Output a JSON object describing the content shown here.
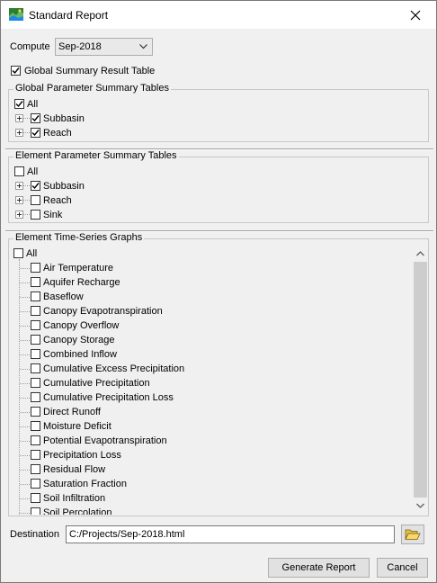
{
  "window": {
    "title": "Standard Report"
  },
  "compute": {
    "label": "Compute",
    "selected": "Sep-2018"
  },
  "global_summary": {
    "label": "Global Summary Result Table",
    "checked": true
  },
  "global_params": {
    "legend": "Global Parameter Summary Tables",
    "all_label": "All",
    "items": [
      {
        "label": "Subbasin",
        "checked": true
      },
      {
        "label": "Reach",
        "checked": true
      }
    ]
  },
  "element_params": {
    "legend": "Element Parameter Summary Tables",
    "all_label": "All",
    "items": [
      {
        "label": "Subbasin",
        "checked": true
      },
      {
        "label": "Reach",
        "checked": false
      },
      {
        "label": "Sink",
        "checked": false
      }
    ]
  },
  "time_series": {
    "legend": "Element Time-Series Graphs",
    "all_label": "All",
    "items": [
      "Air Temperature",
      "Aquifer Recharge",
      "Baseflow",
      "Canopy Evapotranspiration",
      "Canopy Overflow",
      "Canopy Storage",
      "Combined Inflow",
      "Cumulative Excess Precipitation",
      "Cumulative Precipitation",
      "Cumulative Precipitation Loss",
      "Direct Runoff",
      "Moisture Deficit",
      "Potential Evapotranspiration",
      "Precipitation Loss",
      "Residual Flow",
      "Saturation Fraction",
      "Soil Infiltration",
      "Soil Percolation"
    ]
  },
  "destination": {
    "label": "Destination",
    "value": "C:/Projects/Sep-2018.html"
  },
  "buttons": {
    "generate": "Generate Report",
    "cancel": "Cancel"
  }
}
